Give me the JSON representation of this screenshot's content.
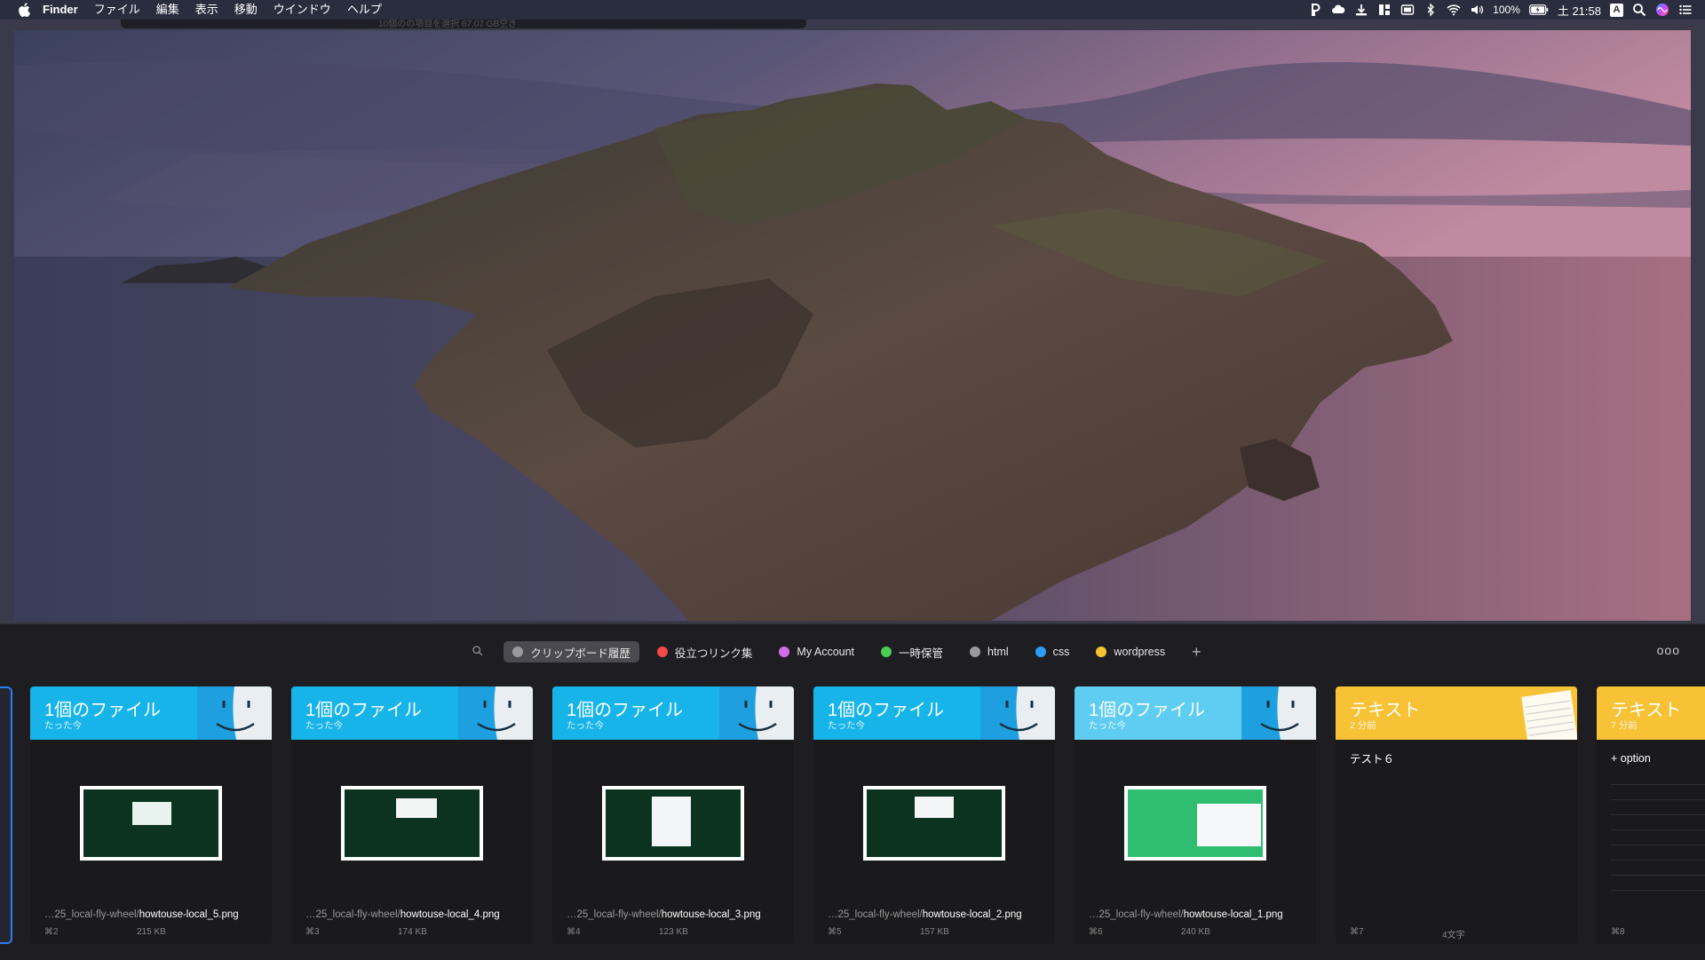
{
  "menubar": {
    "app": "Finder",
    "items": [
      "ファイル",
      "編集",
      "表示",
      "移動",
      "ウインドウ",
      "ヘルプ"
    ],
    "battery": "100%",
    "clock": "土 21:58",
    "input_mode": "A",
    "icons": [
      "apple-icon",
      "paste-p-icon",
      "cloud-icon",
      "download-icon",
      "grid-icon",
      "display-icon",
      "bluetooth-icon",
      "wifi-icon",
      "volume-icon",
      "battery-icon",
      "input-source-icon",
      "spotlight-icon",
      "siri-icon",
      "notification-center-icon"
    ]
  },
  "hidden_window": {
    "text": "10個のの項目を選択 67.07 GB空き"
  },
  "panel": {
    "pinboards": [
      {
        "label": "クリップボード履歴",
        "color": "#9a9a9e",
        "active": true
      },
      {
        "label": "役立つリンク集",
        "color": "#f2494a"
      },
      {
        "label": "My Account",
        "color": "#d06ee8"
      },
      {
        "label": "一時保管",
        "color": "#4cce54"
      },
      {
        "label": "html",
        "color": "#9a9a9e"
      },
      {
        "label": "css",
        "color": "#2d9cf5"
      },
      {
        "label": "wordpress",
        "color": "#f6c431"
      }
    ],
    "more_label": "ooo",
    "cards": [
      {
        "title": "1個のファイル",
        "time": "たった今",
        "path_prefix": "…25_local-fly-wheel/",
        "filename": "howtouse-local_5.png",
        "shortcut": "⌘2",
        "size": "215 KB"
      },
      {
        "title": "1個のファイル",
        "time": "たった今",
        "path_prefix": "…25_local-fly-wheel/",
        "filename": "howtouse-local_4.png",
        "shortcut": "⌘3",
        "size": "174 KB"
      },
      {
        "title": "1個のファイル",
        "time": "たった今",
        "path_prefix": "…25_local-fly-wheel/",
        "filename": "howtouse-local_3.png",
        "shortcut": "⌘4",
        "size": "123 KB"
      },
      {
        "title": "1個のファイル",
        "time": "たった今",
        "path_prefix": "…25_local-fly-wheel/",
        "filename": "howtouse-local_2.png",
        "shortcut": "⌘5",
        "size": "157 KB"
      },
      {
        "title": "1個のファイル",
        "time": "たった今",
        "path_prefix": "…25_local-fly-wheel/",
        "filename": "howtouse-local_1.png",
        "shortcut": "⌘6",
        "size": "240 KB"
      },
      {
        "title": "テキスト",
        "time": "2 分前",
        "content": "テスト６",
        "shortcut": "⌘7",
        "size": "4文字"
      },
      {
        "title": "テキスト",
        "time": "7 分前",
        "content": "+ option",
        "shortcut": "⌘8"
      }
    ]
  },
  "colors": {
    "file_header": "#17b4ea",
    "text_header": "#f7c235",
    "selection": "#2c7cf6"
  }
}
